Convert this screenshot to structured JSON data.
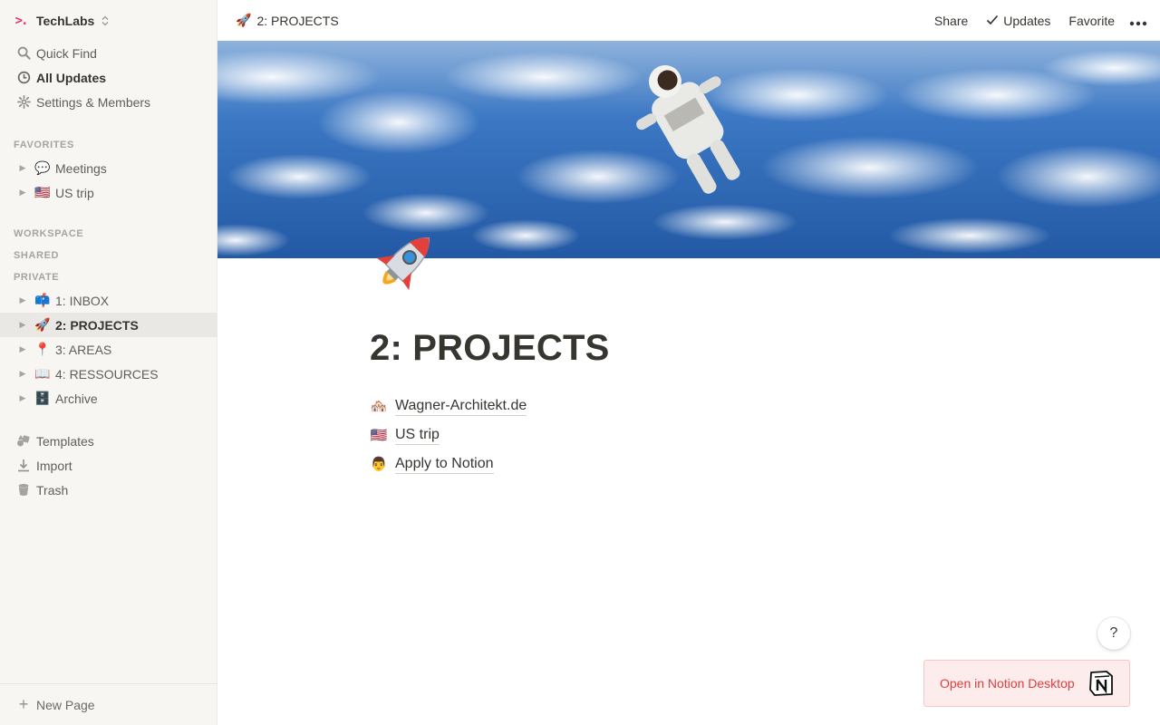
{
  "workspace": {
    "name": "TechLabs",
    "logo": ">."
  },
  "sidebar": {
    "top_items": [
      {
        "label": "Quick Find",
        "icon": "search-icon"
      },
      {
        "label": "All Updates",
        "icon": "clock-icon"
      },
      {
        "label": "Settings & Members",
        "icon": "gear-icon"
      }
    ],
    "favorites_title": "FAVORITES",
    "favorites": [
      {
        "emoji": "💬",
        "label": "Meetings"
      },
      {
        "emoji": "🇺🇸",
        "label": "US trip"
      }
    ],
    "workspace_title": "WORKSPACE",
    "shared_title": "SHARED",
    "private_title": "PRIVATE",
    "private": [
      {
        "emoji": "📫",
        "label": "1: INBOX"
      },
      {
        "emoji": "🚀",
        "label": "2: PROJECTS"
      },
      {
        "emoji": "📍",
        "label": "3: AREAS"
      },
      {
        "emoji": "📖",
        "label": "4: RESSOURCES"
      },
      {
        "emoji": "🗄️",
        "label": "Archive"
      }
    ],
    "bottom_items": [
      {
        "label": "Templates",
        "icon": "templates-icon"
      },
      {
        "label": "Import",
        "icon": "import-icon"
      },
      {
        "label": "Trash",
        "icon": "trash-icon"
      }
    ],
    "new_page": "New Page"
  },
  "topbar": {
    "breadcrumb_emoji": "🚀",
    "breadcrumb": "2: PROJECTS",
    "share": "Share",
    "updates": "Updates",
    "favorite": "Favorite"
  },
  "page": {
    "title": "2: PROJECTS",
    "links": [
      {
        "emoji": "🏘️",
        "label": "Wagner-Architekt.de"
      },
      {
        "emoji": "🇺🇸",
        "label": "US trip"
      },
      {
        "emoji": "👨",
        "label": "Apply to Notion"
      }
    ]
  },
  "help": "?",
  "open_desktop": "Open in Notion Desktop",
  "colors": {
    "accent": "#e8326f",
    "sidebar_bg": "#f7f6f3",
    "desktop_button_text": "#e03e3e"
  }
}
